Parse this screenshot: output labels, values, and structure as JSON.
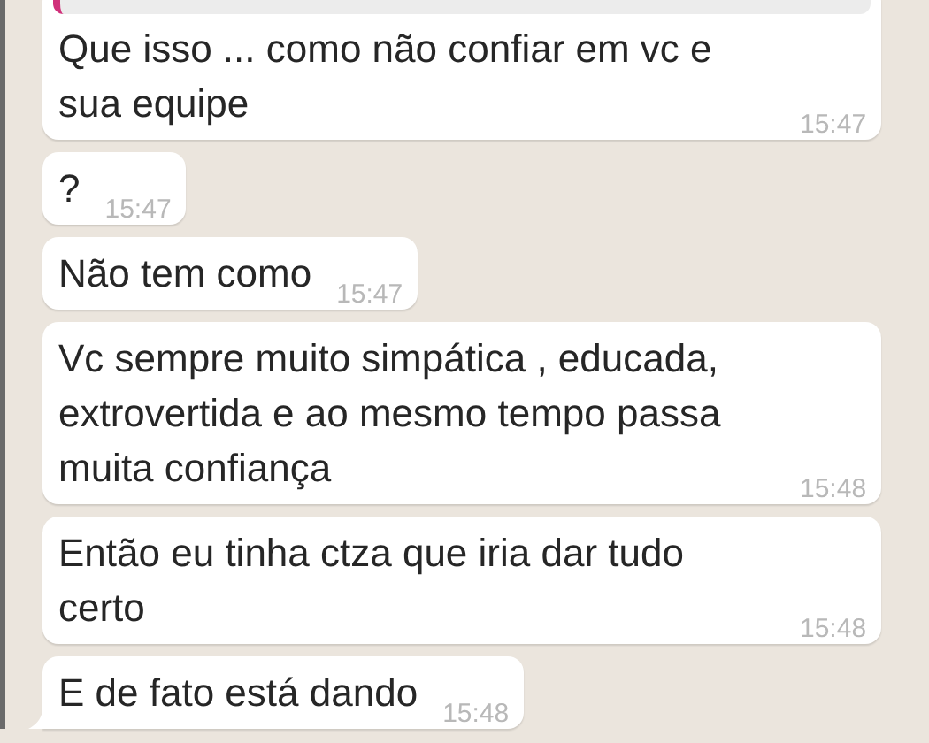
{
  "messages": [
    {
      "text": "Que isso ... como não confiar em vc e sua equipe",
      "time": "15:47",
      "reply_preview": true,
      "tail": false
    },
    {
      "text": "?",
      "time": "15:47",
      "reply_preview": false,
      "tail": false
    },
    {
      "text": "Não tem como",
      "time": "15:47",
      "reply_preview": false,
      "tail": false
    },
    {
      "text": "Vc sempre muito simpática , educada, extrovertida e ao mesmo tempo passa muita confiança",
      "time": "15:48",
      "reply_preview": false,
      "tail": false
    },
    {
      "text": "Então eu tinha ctza que iria dar tudo certo",
      "time": "15:48",
      "reply_preview": false,
      "tail": false
    },
    {
      "text": "E de fato está dando",
      "time": "15:48",
      "reply_preview": false,
      "tail": true
    }
  ]
}
